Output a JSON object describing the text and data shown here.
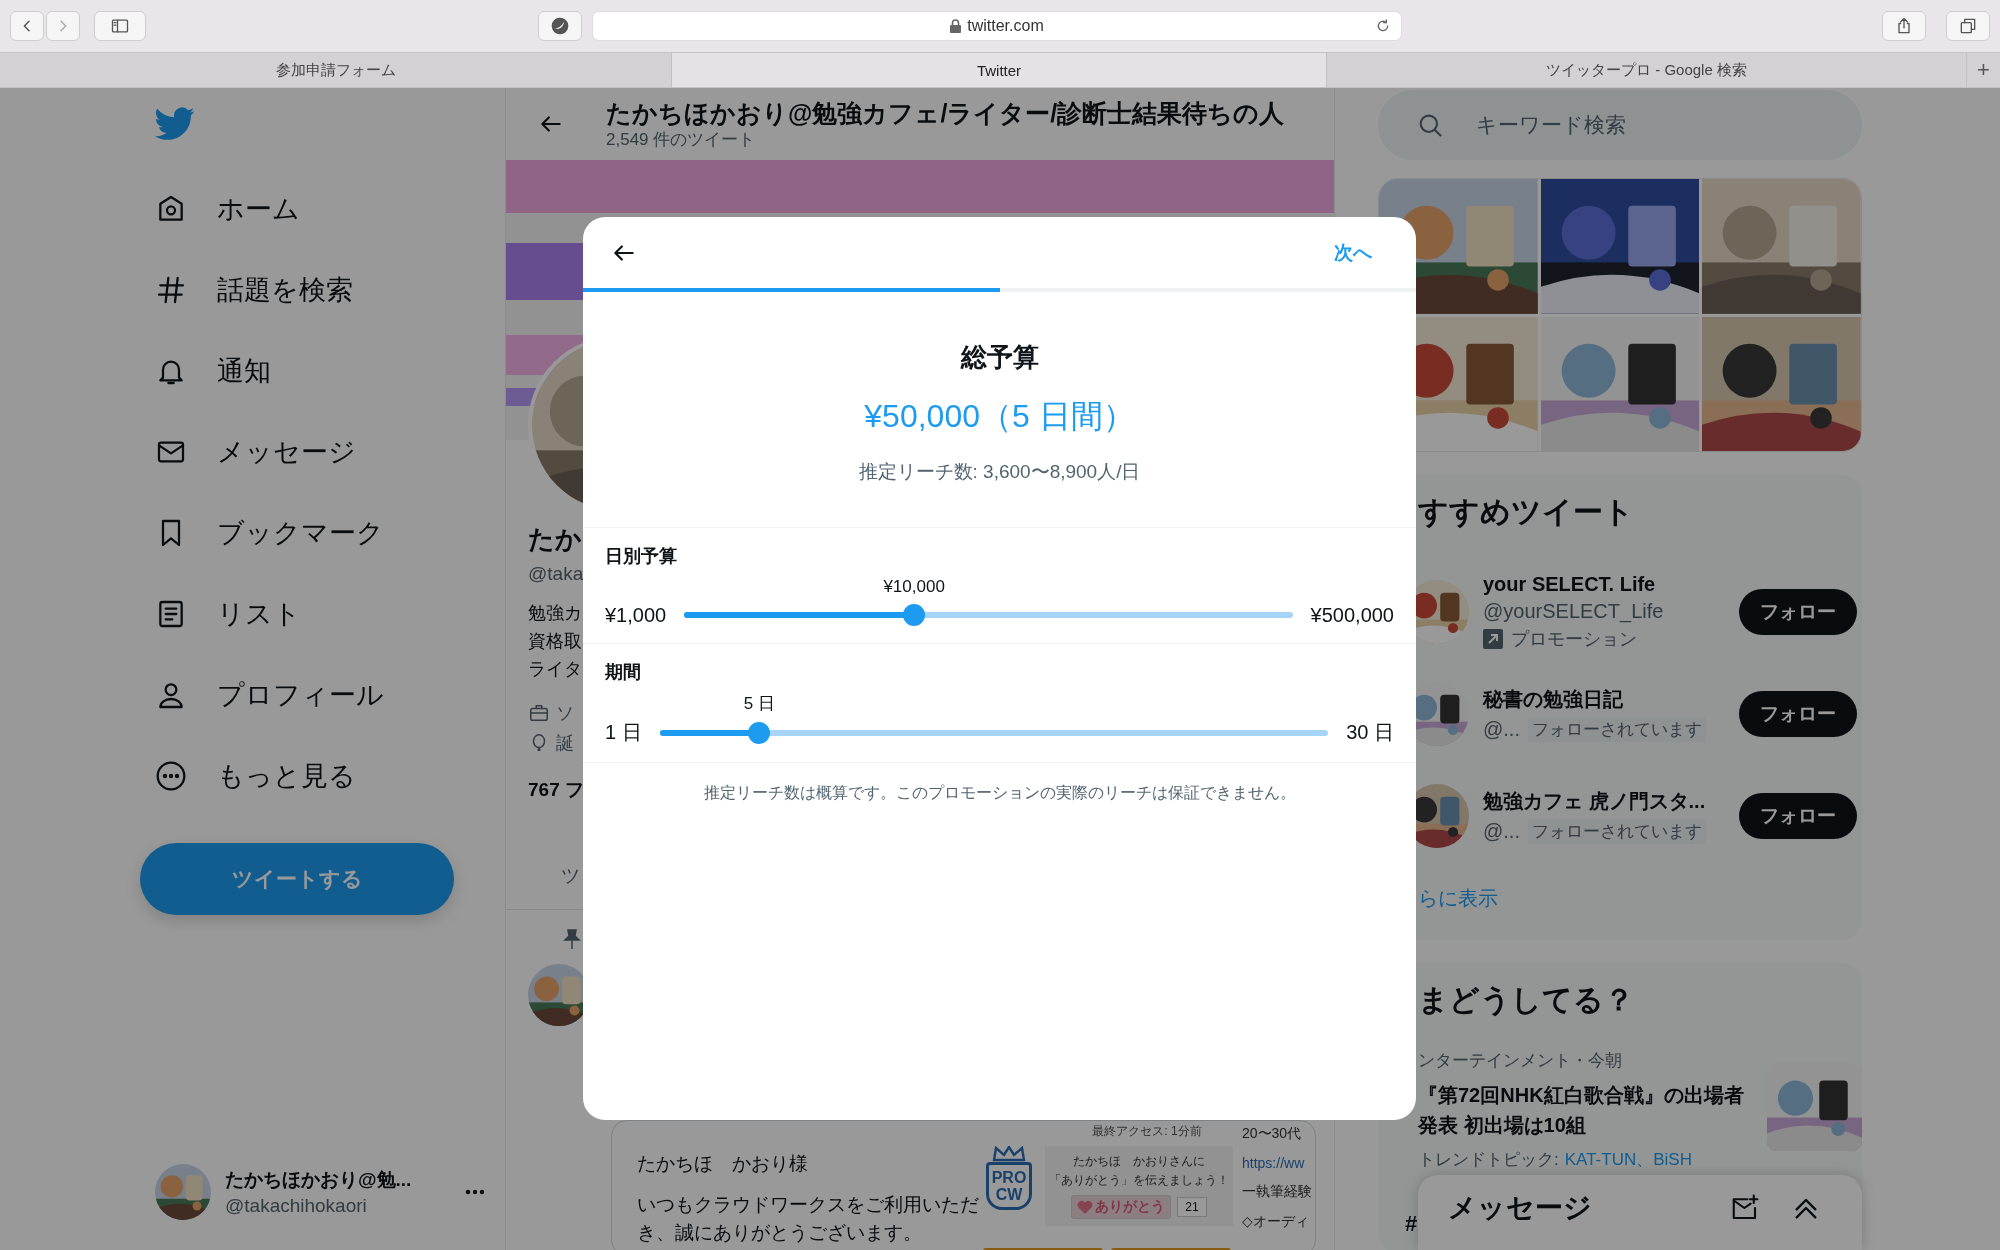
{
  "browser": {
    "url": "twitter.com",
    "tabs": [
      {
        "label": "参加申請フォーム",
        "selected": false
      },
      {
        "label": "Twitter",
        "selected": true
      },
      {
        "label": "ツイッタープロ - Google 検索",
        "selected": false
      }
    ],
    "new_tab": "+"
  },
  "sidebar": {
    "nav": [
      {
        "kind": "home",
        "label": "ホーム"
      },
      {
        "kind": "explore",
        "label": "話題を検索"
      },
      {
        "kind": "notifications",
        "label": "通知"
      },
      {
        "kind": "messages",
        "label": "メッセージ"
      },
      {
        "kind": "bookmarks",
        "label": "ブックマーク"
      },
      {
        "kind": "lists",
        "label": "リスト"
      },
      {
        "kind": "profile",
        "label": "プロフィール"
      },
      {
        "kind": "more",
        "label": "もっと見る"
      }
    ],
    "tweet_button": "ツイートする",
    "account": {
      "name": "たかちほかおり@勉...",
      "handle": "@takachihokaori"
    }
  },
  "profile": {
    "title": "たかちほかおり@勉強カフェ/ライター/診断士結果待ちの人",
    "tweet_count": "2,549 件のツイート",
    "name": "たか",
    "handle": "@taka",
    "bio": [
      "勉強カ",
      "資格取",
      "ライタ"
    ],
    "meta": [
      {
        "kind": "work",
        "text": "ソ"
      },
      {
        "kind": "birthday",
        "text": "誕"
      }
    ],
    "following": "767 フ",
    "tab": "ツ"
  },
  "tweet": {
    "embed": {
      "greeting": "たかちほ　かおり様",
      "body": "いつもクラウドワークスをご利用いただき、誠にありがとうございます。",
      "last_access": "最終アクセス: 1分前",
      "badge": [
        "PRO",
        "CW"
      ],
      "thanks_text": [
        "たかちほ　かおりさんに",
        "「ありがとう」を伝えましょう！"
      ],
      "thanks_button": "ありがとう",
      "thanks_count": "21",
      "side": [
        "20〜30代",
        "https://ww",
        "一執筆経験",
        "◇オーディ"
      ]
    }
  },
  "modal": {
    "next": "次へ",
    "progress": {
      "level": 0.5
    },
    "title": "総予算",
    "amount": "¥50,000（5 日間）",
    "reach": "推定リーチ数: 3,600〜8,900人/日",
    "sliders": [
      {
        "label": "日別予算",
        "min": "¥1,000",
        "max": "¥500,000",
        "value": "¥10,000",
        "level": 0.378
      },
      {
        "label": "期間",
        "min": "1 日",
        "max": "30 日",
        "value": "5 日",
        "level": 0.149
      }
    ],
    "note": "推定リーチ数は概算です。このプロモーションの実際のリーチは保証できません。"
  },
  "search": {
    "placeholder": "キーワード検索"
  },
  "recommended": {
    "title": "すすめツイート",
    "accounts": [
      {
        "name": "your SELECT. Life",
        "handle": "@yourSELECT_Life",
        "promoted": "プロモーション",
        "follow": "フォロー"
      },
      {
        "name": "秘書の勉強日記",
        "handle": "@...",
        "follows_you": "フォローされています",
        "follow": "フォロー"
      },
      {
        "name": "勉強カフェ 虎ノ門スタ...",
        "handle": "@...",
        "follows_you": "フォローされています",
        "follow": "フォロー"
      }
    ],
    "show_more": "らに表示"
  },
  "trends": {
    "title": "まどうしてる？",
    "items": [
      {
        "context": "ンターテインメント・今朝",
        "headline": "『第72回NHK紅白歌合戦』の出場者発表 初出場は10組",
        "topics_label": "トレンドトピック:",
        "topics": "KAT-TUN、BiSH"
      }
    ],
    "next": "#"
  },
  "messages": {
    "title": "メッセージ"
  }
}
